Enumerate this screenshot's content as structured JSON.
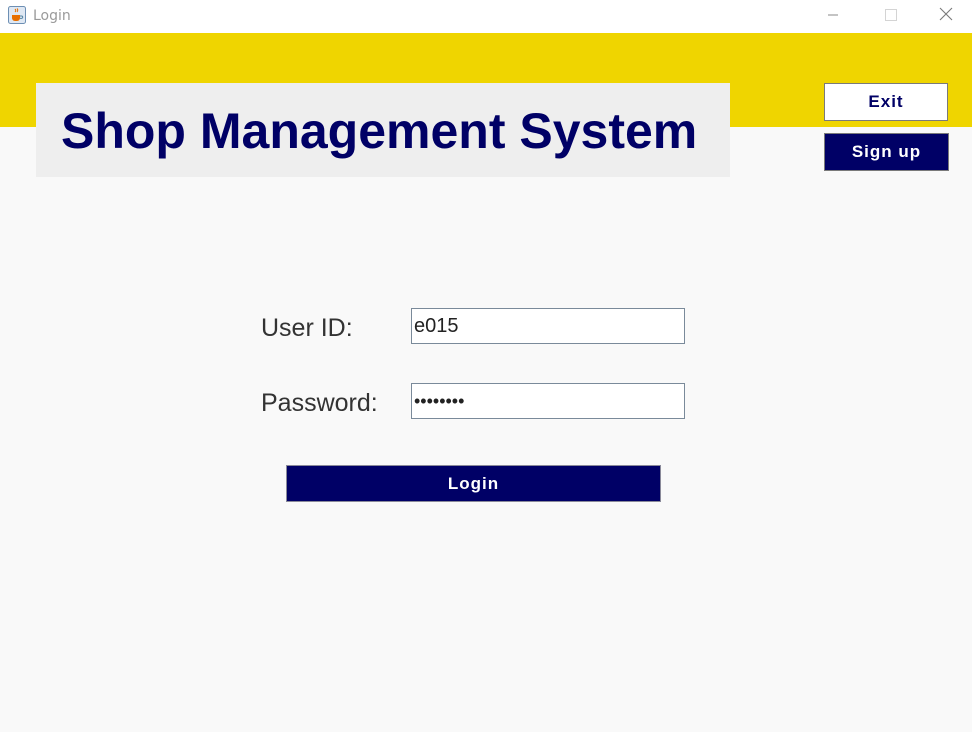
{
  "window": {
    "title": "Login",
    "icon": "java-cup-icon",
    "controls": [
      "minimize-icon",
      "maximize-icon",
      "close-icon"
    ]
  },
  "header": {
    "title": "Shop Management System"
  },
  "actions": {
    "exit_label": "Exit",
    "signup_label": "Sign up"
  },
  "form": {
    "userid_label": "User ID:",
    "userid_value": "e015",
    "password_label": "Password:",
    "password_value": "••••••••",
    "login_label": "Login"
  },
  "colors": {
    "header_band": "#efd500",
    "brand_navy": "#000066",
    "title_panel": "#eeeeee",
    "background": "#f9f9f9"
  }
}
